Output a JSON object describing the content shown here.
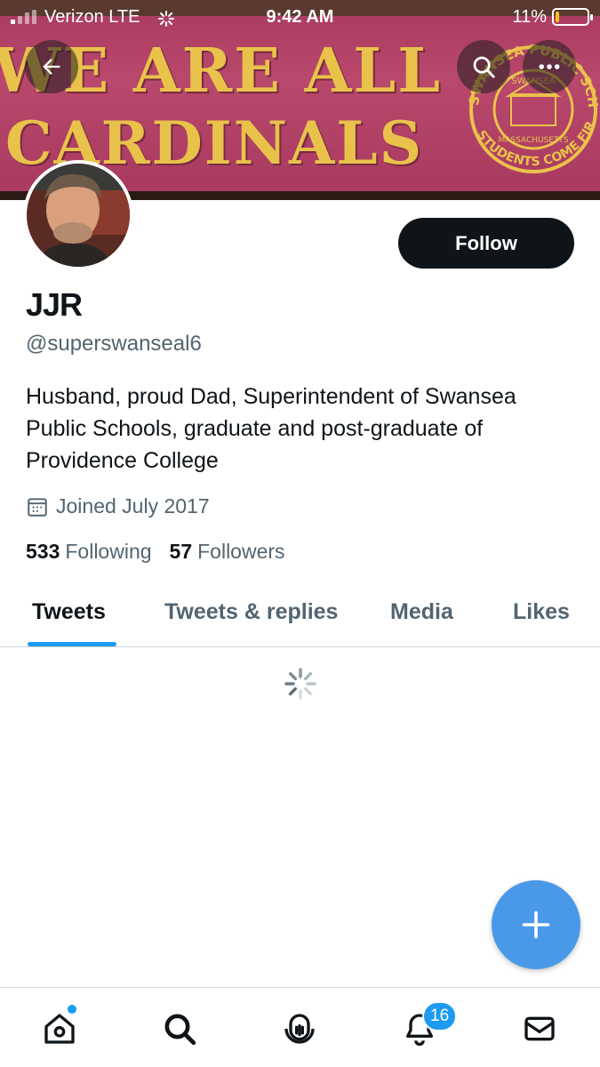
{
  "status_bar": {
    "carrier": "Verizon  LTE",
    "time": "9:42 AM",
    "battery_percent": "11%",
    "battery_level": 0.11,
    "battery_color": "#f5c518"
  },
  "banner": {
    "line1": "WE ARE ALL",
    "line2": "CARDINALS",
    "seal_top_text": "SWANSEA PUBLIC SCHOOLS",
    "seal_town_text": "SWANSEA",
    "seal_state_text": "MASSACHUSETTS",
    "seal_motto_text": "STUDENTS COME FIRST",
    "background_color": "#b0416a",
    "text_color": "#e9c24b"
  },
  "top_buttons": {
    "back_icon": "arrow-left-icon",
    "search_icon": "search-icon",
    "more_icon": "more-horizontal-icon"
  },
  "profile": {
    "follow_label": "Follow",
    "name": "JJR",
    "handle": "@superswanseal6",
    "bio": "Husband, proud Dad, Superintendent of Swansea Public Schools, graduate and post-graduate of Providence College",
    "joined": "Joined July 2017",
    "following_count": "533",
    "following_label": "Following",
    "followers_count": "57",
    "followers_label": "Followers"
  },
  "tabs": [
    {
      "label": "Tweets",
      "active": true
    },
    {
      "label": "Tweets & replies",
      "active": false
    },
    {
      "label": "Media",
      "active": false
    },
    {
      "label": "Likes",
      "active": false
    }
  ],
  "accent_color": "#1d9bf0",
  "fab": {
    "icon": "plus-icon",
    "color": "#4a99e9"
  },
  "bottom_nav": {
    "items": [
      "home-icon",
      "search-icon",
      "spaces-icon",
      "bell-icon",
      "mail-icon"
    ],
    "notification_count": "16"
  }
}
